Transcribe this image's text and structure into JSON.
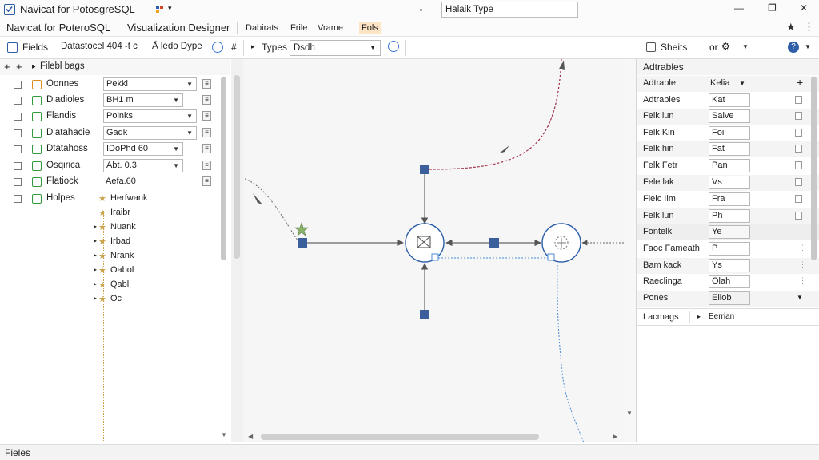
{
  "titlebar": {
    "app_title": "Navicat for PotosgreSQL",
    "search_value": "Halaik Type",
    "min_glyph": "—",
    "max_glyph": "❐",
    "close_glyph": "✕"
  },
  "menubar": {
    "app_name": "Navicat for PoteroSQL",
    "designer_title": "Visualization Designer",
    "tabs": [
      {
        "label": "Dabirats"
      },
      {
        "label": "Frile"
      },
      {
        "label": "Vrame"
      },
      {
        "label": "Fols"
      }
    ],
    "star_glyph": "★",
    "more_glyph": "⋮"
  },
  "toolbar": {
    "fields_label": "Fields",
    "datastore_label": "Datastocel 404 -t c",
    "fieldtype_label": "Ä ledo Dype",
    "types_label": "Types",
    "type_select_value": "Dsdh",
    "sheets_label": "Sheits",
    "or_label": "or"
  },
  "left_panel": {
    "header_label": "Filebl bags",
    "rows": [
      {
        "name": "Oonnes",
        "value": "Pekki",
        "has_dropdown": true
      },
      {
        "name": "Diadioles",
        "value": "BH1  m",
        "has_dropdown": true
      },
      {
        "name": "Flandis",
        "value": "Poinks",
        "has_dropdown": true
      },
      {
        "name": "Diatahacie",
        "value": "Gadk",
        "has_dropdown": true
      },
      {
        "name": "Dtatahoss",
        "value": "IDoPhd 60",
        "has_dropdown": true
      },
      {
        "name": "Osqirica",
        "value": "Abt. 0.3",
        "has_dropdown": true
      },
      {
        "name": "Flatiock",
        "value": "Aefa.60",
        "has_dropdown": false
      },
      {
        "name": "Holpes",
        "value": "",
        "has_dropdown": false
      }
    ],
    "sub_items": [
      {
        "label": "Herfwank"
      },
      {
        "label": "Iraibr"
      },
      {
        "label": "Nuank"
      },
      {
        "label": "Irbad"
      },
      {
        "label": "Nrank"
      },
      {
        "label": "Oabol"
      },
      {
        "label": "Qabl"
      },
      {
        "label": "Oc"
      }
    ]
  },
  "right_panel": {
    "header_label": "Adtrables",
    "rows": [
      {
        "label": "Adtrable",
        "value": "Kelia",
        "kind": "select"
      },
      {
        "label": "Adtrables",
        "value": "Kat",
        "kind": "input"
      },
      {
        "label": "Felk lun",
        "value": "Saive",
        "kind": "input"
      },
      {
        "label": "Felk Kin",
        "value": "Foi",
        "kind": "input"
      },
      {
        "label": "Felk hin",
        "value": "Fat",
        "kind": "input"
      },
      {
        "label": "Felk Fetr",
        "value": "Pan",
        "kind": "input"
      },
      {
        "label": "Fele lak",
        "value": "Vs",
        "kind": "input"
      },
      {
        "label": "Fielc Iim",
        "value": "Fra",
        "kind": "input"
      },
      {
        "label": "Felk lun",
        "value": "Ph",
        "kind": "input"
      },
      {
        "label": "Fontelk",
        "value": "Ye",
        "kind": "input"
      },
      {
        "label": "Faoc Fameath",
        "value": "P",
        "kind": "input"
      },
      {
        "label": "Bam kack",
        "value": "Ys",
        "kind": "input"
      },
      {
        "label": "Raeclinga",
        "value": "Olah",
        "kind": "input"
      },
      {
        "label": "Pones",
        "value": "Eilob",
        "kind": "input"
      }
    ],
    "footer_label": "Lacmags",
    "footer_value": "Eerrian"
  },
  "statusbar": {
    "label": "Fieles"
  },
  "colors": {
    "accent": "#2e5ea8",
    "node_fill": "#3a5f9a",
    "connector_red": "#a2334a",
    "connector_blue": "#4a8ad6",
    "highlight_tab": "#fde4c4"
  }
}
